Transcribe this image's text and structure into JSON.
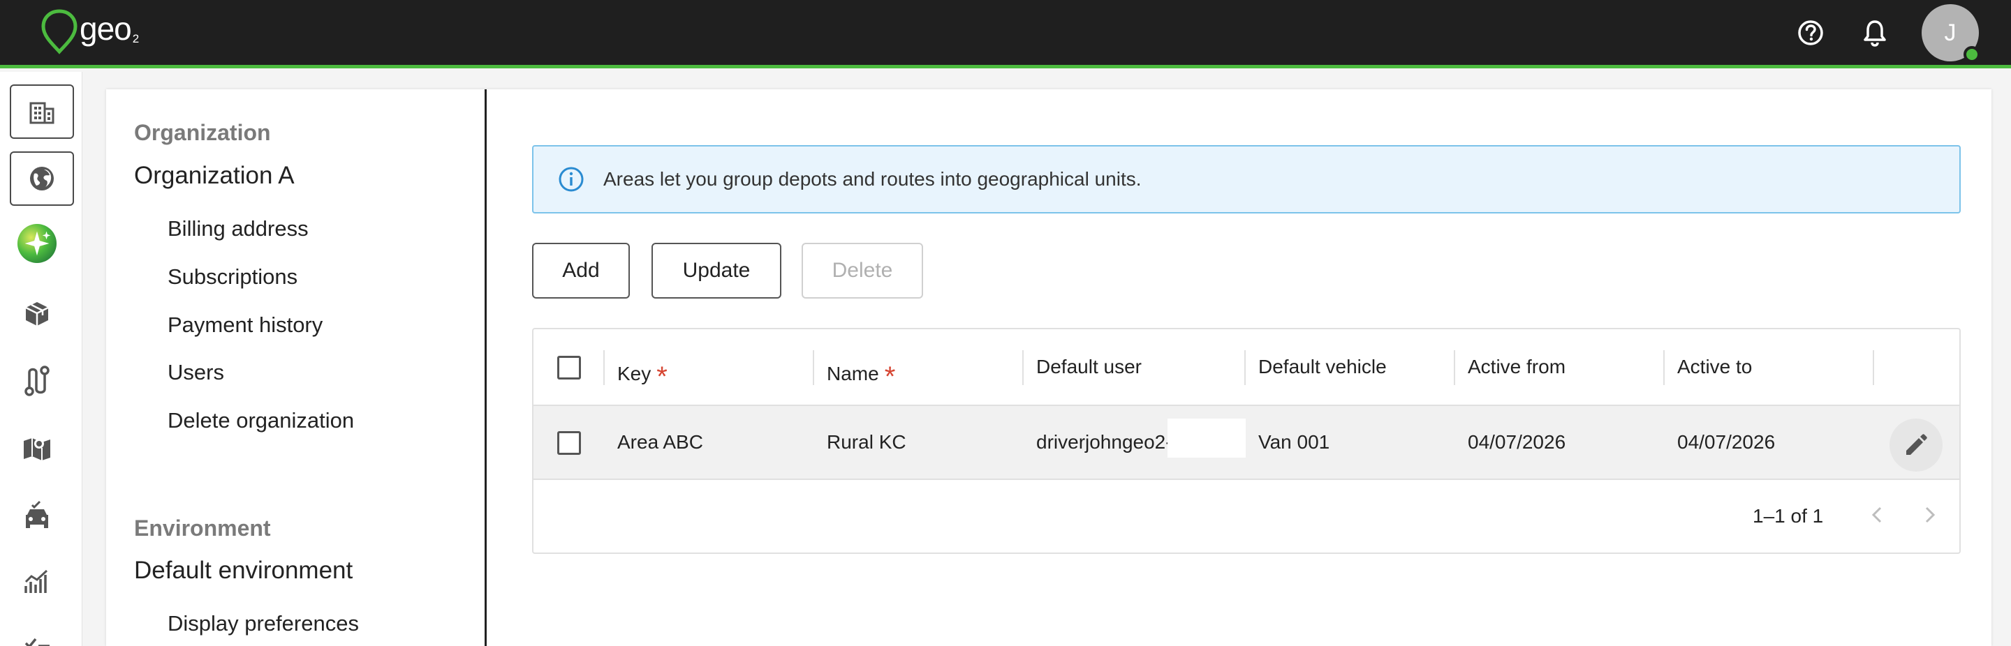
{
  "brand": {
    "name": "geo",
    "sub": "2"
  },
  "user": {
    "initial": "J"
  },
  "icons": {
    "help": "help-icon",
    "notifications": "bell-icon"
  },
  "nav": {
    "organization_heading": "Organization",
    "organization_name": "Organization A",
    "organization_items": [
      "Billing address",
      "Subscriptions",
      "Payment history",
      "Users",
      "Delete organization"
    ],
    "environment_heading": "Environment",
    "environment_name": "Default environment",
    "environment_items": [
      "Display preferences"
    ]
  },
  "info": {
    "text": "Areas let you group depots and routes into geographical units."
  },
  "actions": {
    "add": "Add",
    "update": "Update",
    "delete": "Delete"
  },
  "table": {
    "columns": [
      "Key",
      "Name",
      "Default user",
      "Default vehicle",
      "Active from",
      "Active to"
    ],
    "required_marker": "*",
    "rows": [
      {
        "key": "Area ABC",
        "name": "Rural KC",
        "default_user": "driverjohngeo2-",
        "default_vehicle": "Van 001",
        "active_from": "04/07/2026",
        "active_to": "04/07/2026"
      }
    ],
    "pagination": "1–1 of 1"
  },
  "colors": {
    "accent": "#4cbb3f",
    "topbar": "#1f1f1f",
    "info_bg": "#e8f4fd",
    "info_border": "#7cc3ea",
    "required": "#d64532"
  }
}
